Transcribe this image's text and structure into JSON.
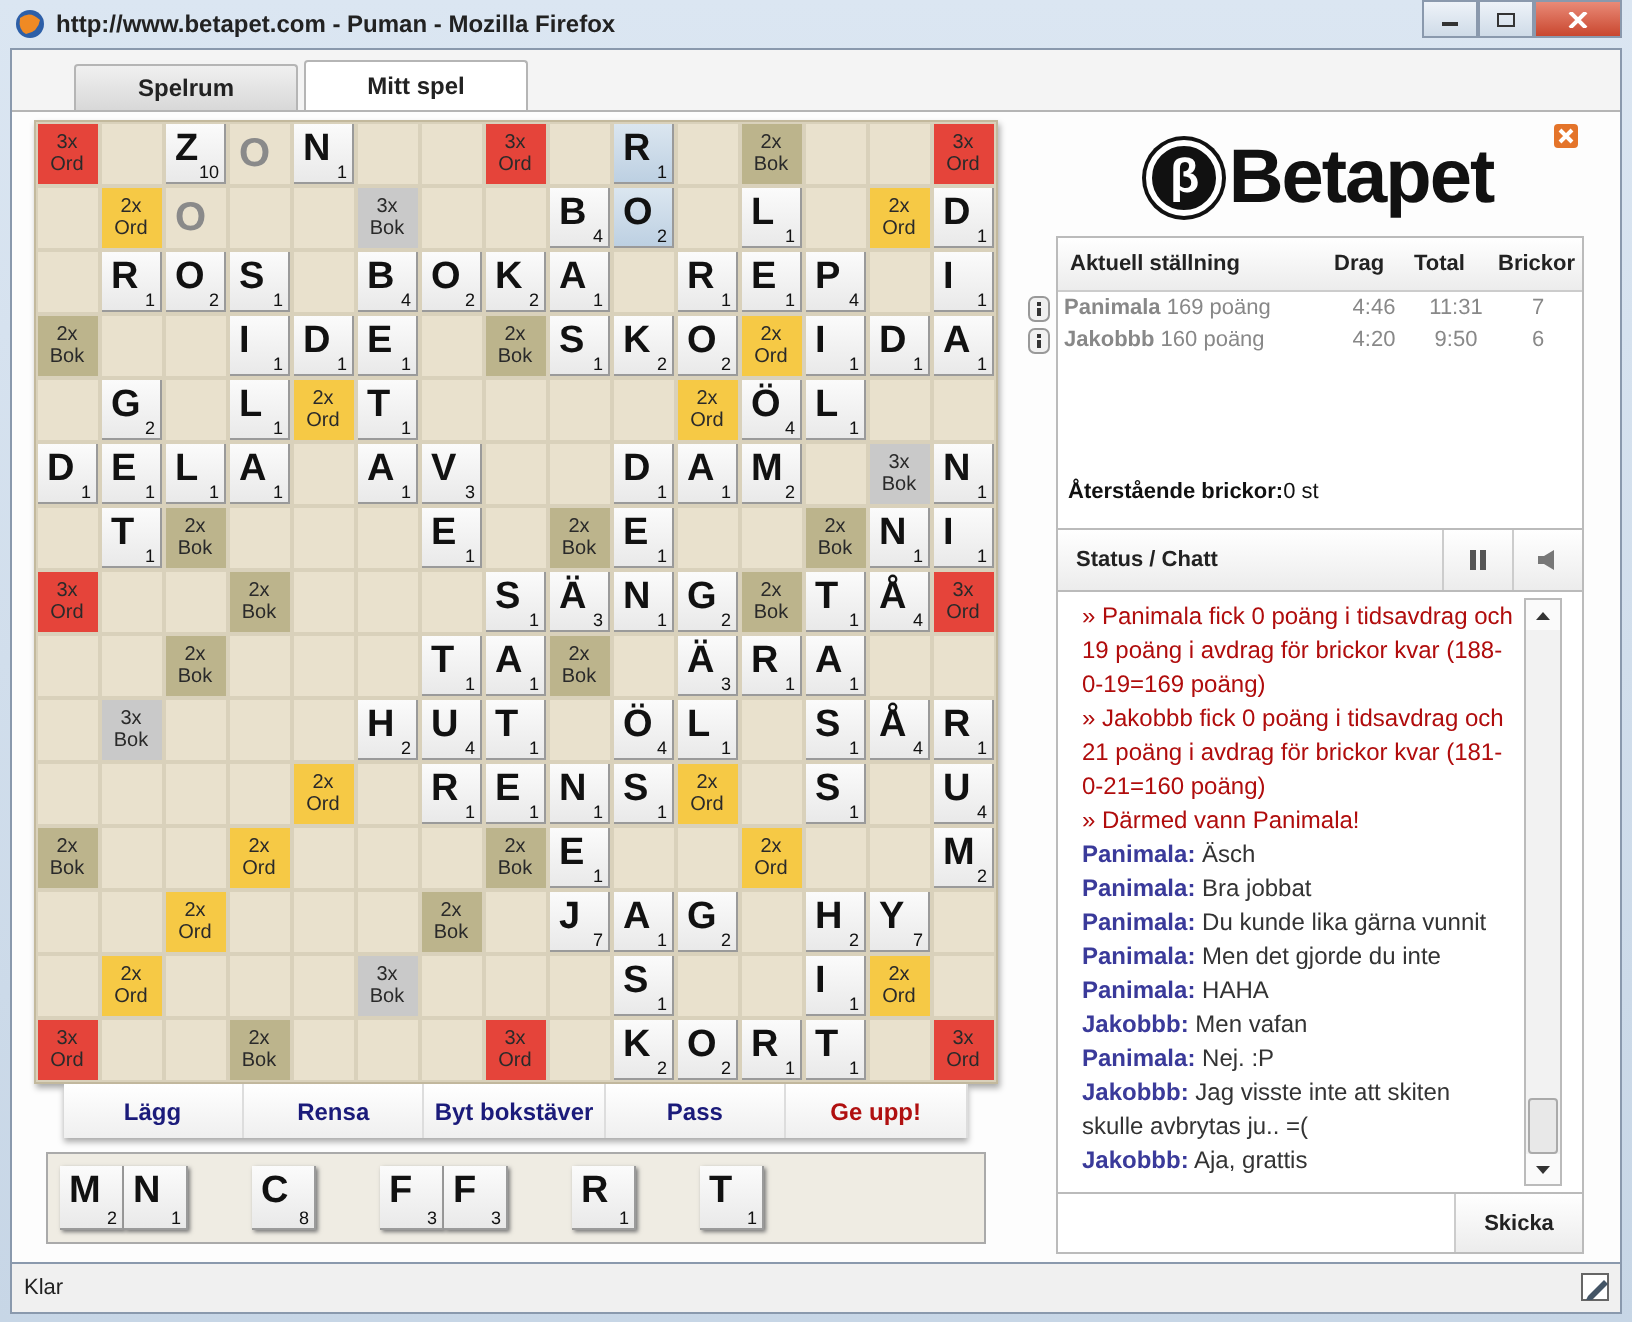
{
  "window": {
    "title": "http://www.betapet.com - Puman - Mozilla Firefox"
  },
  "tabs": [
    {
      "label": "Spelrum",
      "selected": false
    },
    {
      "label": "Mitt spel",
      "selected": true
    }
  ],
  "board": [
    [
      {
        "kind": "bonus",
        "mult": "3x",
        "word": "Ord",
        "color": "#e5443a"
      },
      {
        "kind": "empty"
      },
      {
        "kind": "tile",
        "letter": "Z",
        "points": "10",
        "highlighted": false
      },
      {
        "kind": "blank",
        "letter": "O"
      },
      {
        "kind": "tile",
        "letter": "N",
        "points": "1",
        "highlighted": false
      },
      {
        "kind": "empty"
      },
      {
        "kind": "empty"
      },
      {
        "kind": "bonus",
        "mult": "3x",
        "word": "Ord",
        "color": "#e5443a"
      },
      {
        "kind": "empty"
      },
      {
        "kind": "tile",
        "letter": "R",
        "points": "1",
        "highlighted": true
      },
      {
        "kind": "empty"
      },
      {
        "kind": "bonus",
        "mult": "2x",
        "word": "Bok",
        "color": "#bcb48c"
      },
      {
        "kind": "empty"
      },
      {
        "kind": "empty"
      },
      {
        "kind": "bonus",
        "mult": "3x",
        "word": "Ord",
        "color": "#e5443a"
      }
    ],
    [
      {
        "kind": "empty"
      },
      {
        "kind": "bonus",
        "mult": "2x",
        "word": "Ord",
        "color": "#f6c945"
      },
      {
        "kind": "blank",
        "letter": "O"
      },
      {
        "kind": "empty"
      },
      {
        "kind": "empty"
      },
      {
        "kind": "bonus",
        "mult": "3x",
        "word": "Bok",
        "color": "#c9c9c9"
      },
      {
        "kind": "empty"
      },
      {
        "kind": "empty"
      },
      {
        "kind": "tile",
        "letter": "B",
        "points": "4",
        "highlighted": false
      },
      {
        "kind": "tile",
        "letter": "O",
        "points": "2",
        "highlighted": true
      },
      {
        "kind": "empty"
      },
      {
        "kind": "tile",
        "letter": "L",
        "points": "1",
        "highlighted": false
      },
      {
        "kind": "empty"
      },
      {
        "kind": "bonus",
        "mult": "2x",
        "word": "Ord",
        "color": "#f6c945"
      },
      {
        "kind": "tile",
        "letter": "D",
        "points": "1",
        "highlighted": false
      }
    ],
    [
      {
        "kind": "empty"
      },
      {
        "kind": "tile",
        "letter": "R",
        "points": "1",
        "highlighted": false
      },
      {
        "kind": "tile",
        "letter": "O",
        "points": "2",
        "highlighted": false
      },
      {
        "kind": "tile",
        "letter": "S",
        "points": "1",
        "highlighted": false
      },
      {
        "kind": "empty"
      },
      {
        "kind": "tile",
        "letter": "B",
        "points": "4",
        "highlighted": false
      },
      {
        "kind": "tile",
        "letter": "O",
        "points": "2",
        "highlighted": false
      },
      {
        "kind": "tile",
        "letter": "K",
        "points": "2",
        "highlighted": false
      },
      {
        "kind": "tile",
        "letter": "A",
        "points": "1",
        "highlighted": false
      },
      {
        "kind": "empty"
      },
      {
        "kind": "tile",
        "letter": "R",
        "points": "1",
        "highlighted": false
      },
      {
        "kind": "tile",
        "letter": "E",
        "points": "1",
        "highlighted": false
      },
      {
        "kind": "tile",
        "letter": "P",
        "points": "4",
        "highlighted": false
      },
      {
        "kind": "empty"
      },
      {
        "kind": "tile",
        "letter": "I",
        "points": "1",
        "highlighted": false
      }
    ],
    [
      {
        "kind": "bonus",
        "mult": "2x",
        "word": "Bok",
        "color": "#bcb48c"
      },
      {
        "kind": "empty"
      },
      {
        "kind": "empty"
      },
      {
        "kind": "tile",
        "letter": "I",
        "points": "1",
        "highlighted": false
      },
      {
        "kind": "tile",
        "letter": "D",
        "points": "1",
        "highlighted": false
      },
      {
        "kind": "tile",
        "letter": "E",
        "points": "1",
        "highlighted": false
      },
      {
        "kind": "empty"
      },
      {
        "kind": "bonus",
        "mult": "2x",
        "word": "Bok",
        "color": "#bcb48c"
      },
      {
        "kind": "tile",
        "letter": "S",
        "points": "1",
        "highlighted": false
      },
      {
        "kind": "tile",
        "letter": "K",
        "points": "2",
        "highlighted": false
      },
      {
        "kind": "tile",
        "letter": "O",
        "points": "2",
        "highlighted": false
      },
      {
        "kind": "bonus",
        "mult": "2x",
        "word": "Ord",
        "color": "#f6c945"
      },
      {
        "kind": "tile",
        "letter": "I",
        "points": "1",
        "highlighted": false
      },
      {
        "kind": "tile",
        "letter": "D",
        "points": "1",
        "highlighted": false
      },
      {
        "kind": "tile",
        "letter": "A",
        "points": "1",
        "highlighted": false
      }
    ],
    [
      {
        "kind": "empty"
      },
      {
        "kind": "tile",
        "letter": "G",
        "points": "2",
        "highlighted": false
      },
      {
        "kind": "empty"
      },
      {
        "kind": "tile",
        "letter": "L",
        "points": "1",
        "highlighted": false
      },
      {
        "kind": "bonus",
        "mult": "2x",
        "word": "Ord",
        "color": "#f6c945"
      },
      {
        "kind": "tile",
        "letter": "T",
        "points": "1",
        "highlighted": false
      },
      {
        "kind": "empty"
      },
      {
        "kind": "empty"
      },
      {
        "kind": "empty"
      },
      {
        "kind": "empty"
      },
      {
        "kind": "bonus",
        "mult": "2x",
        "word": "Ord",
        "color": "#f6c945"
      },
      {
        "kind": "tile",
        "letter": "Ö",
        "points": "4",
        "highlighted": false
      },
      {
        "kind": "tile",
        "letter": "L",
        "points": "1",
        "highlighted": false
      },
      {
        "kind": "empty"
      },
      {
        "kind": "empty"
      }
    ],
    [
      {
        "kind": "tile",
        "letter": "D",
        "points": "1",
        "highlighted": false
      },
      {
        "kind": "tile",
        "letter": "E",
        "points": "1",
        "highlighted": false
      },
      {
        "kind": "tile",
        "letter": "L",
        "points": "1",
        "highlighted": false
      },
      {
        "kind": "tile",
        "letter": "A",
        "points": "1",
        "highlighted": false
      },
      {
        "kind": "empty"
      },
      {
        "kind": "tile",
        "letter": "A",
        "points": "1",
        "highlighted": false
      },
      {
        "kind": "tile",
        "letter": "V",
        "points": "3",
        "highlighted": false
      },
      {
        "kind": "empty"
      },
      {
        "kind": "empty"
      },
      {
        "kind": "tile",
        "letter": "D",
        "points": "1",
        "highlighted": false
      },
      {
        "kind": "tile",
        "letter": "A",
        "points": "1",
        "highlighted": false
      },
      {
        "kind": "tile",
        "letter": "M",
        "points": "2",
        "highlighted": false
      },
      {
        "kind": "empty"
      },
      {
        "kind": "bonus",
        "mult": "3x",
        "word": "Bok",
        "color": "#c9c9c9"
      },
      {
        "kind": "tile",
        "letter": "N",
        "points": "1",
        "highlighted": false
      }
    ],
    [
      {
        "kind": "empty"
      },
      {
        "kind": "tile",
        "letter": "T",
        "points": "1",
        "highlighted": false
      },
      {
        "kind": "bonus",
        "mult": "2x",
        "word": "Bok",
        "color": "#bcb48c"
      },
      {
        "kind": "empty"
      },
      {
        "kind": "empty"
      },
      {
        "kind": "empty"
      },
      {
        "kind": "tile",
        "letter": "E",
        "points": "1",
        "highlighted": false
      },
      {
        "kind": "empty"
      },
      {
        "kind": "bonus",
        "mult": "2x",
        "word": "Bok",
        "color": "#bcb48c"
      },
      {
        "kind": "tile",
        "letter": "E",
        "points": "1",
        "highlighted": false
      },
      {
        "kind": "empty"
      },
      {
        "kind": "empty"
      },
      {
        "kind": "bonus",
        "mult": "2x",
        "word": "Bok",
        "color": "#bcb48c"
      },
      {
        "kind": "tile",
        "letter": "N",
        "points": "1",
        "highlighted": false
      },
      {
        "kind": "tile",
        "letter": "I",
        "points": "1",
        "highlighted": false
      }
    ],
    [
      {
        "kind": "bonus",
        "mult": "3x",
        "word": "Ord",
        "color": "#e5443a"
      },
      {
        "kind": "empty"
      },
      {
        "kind": "empty"
      },
      {
        "kind": "bonus",
        "mult": "2x",
        "word": "Bok",
        "color": "#bcb48c"
      },
      {
        "kind": "empty"
      },
      {
        "kind": "empty"
      },
      {
        "kind": "empty"
      },
      {
        "kind": "tile",
        "letter": "S",
        "points": "1",
        "highlighted": false
      },
      {
        "kind": "tile",
        "letter": "Ä",
        "points": "3",
        "highlighted": false
      },
      {
        "kind": "tile",
        "letter": "N",
        "points": "1",
        "highlighted": false
      },
      {
        "kind": "tile",
        "letter": "G",
        "points": "2",
        "highlighted": false
      },
      {
        "kind": "bonus",
        "mult": "2x",
        "word": "Bok",
        "color": "#bcb48c"
      },
      {
        "kind": "tile",
        "letter": "T",
        "points": "1",
        "highlighted": false
      },
      {
        "kind": "tile",
        "letter": "Å",
        "points": "4",
        "highlighted": false
      },
      {
        "kind": "bonus",
        "mult": "3x",
        "word": "Ord",
        "color": "#e5443a"
      }
    ],
    [
      {
        "kind": "empty"
      },
      {
        "kind": "empty"
      },
      {
        "kind": "bonus",
        "mult": "2x",
        "word": "Bok",
        "color": "#bcb48c"
      },
      {
        "kind": "empty"
      },
      {
        "kind": "empty"
      },
      {
        "kind": "empty"
      },
      {
        "kind": "tile",
        "letter": "T",
        "points": "1",
        "highlighted": false
      },
      {
        "kind": "tile",
        "letter": "A",
        "points": "1",
        "highlighted": false
      },
      {
        "kind": "bonus",
        "mult": "2x",
        "word": "Bok",
        "color": "#bcb48c"
      },
      {
        "kind": "empty"
      },
      {
        "kind": "tile",
        "letter": "Ä",
        "points": "3",
        "highlighted": false
      },
      {
        "kind": "tile",
        "letter": "R",
        "points": "1",
        "highlighted": false
      },
      {
        "kind": "tile",
        "letter": "A",
        "points": "1",
        "highlighted": false
      },
      {
        "kind": "empty"
      },
      {
        "kind": "empty"
      }
    ],
    [
      {
        "kind": "empty"
      },
      {
        "kind": "bonus",
        "mult": "3x",
        "word": "Bok",
        "color": "#c9c9c9"
      },
      {
        "kind": "empty"
      },
      {
        "kind": "empty"
      },
      {
        "kind": "empty"
      },
      {
        "kind": "tile",
        "letter": "H",
        "points": "2",
        "highlighted": false
      },
      {
        "kind": "tile",
        "letter": "U",
        "points": "4",
        "highlighted": false
      },
      {
        "kind": "tile",
        "letter": "T",
        "points": "1",
        "highlighted": false
      },
      {
        "kind": "empty"
      },
      {
        "kind": "tile",
        "letter": "Ö",
        "points": "4",
        "highlighted": false
      },
      {
        "kind": "tile",
        "letter": "L",
        "points": "1",
        "highlighted": false
      },
      {
        "kind": "empty"
      },
      {
        "kind": "tile",
        "letter": "S",
        "points": "1",
        "highlighted": false
      },
      {
        "kind": "tile",
        "letter": "Å",
        "points": "4",
        "highlighted": false
      },
      {
        "kind": "tile",
        "letter": "R",
        "points": "1",
        "highlighted": false
      }
    ],
    [
      {
        "kind": "empty"
      },
      {
        "kind": "empty"
      },
      {
        "kind": "empty"
      },
      {
        "kind": "empty"
      },
      {
        "kind": "bonus",
        "mult": "2x",
        "word": "Ord",
        "color": "#f6c945"
      },
      {
        "kind": "empty"
      },
      {
        "kind": "tile",
        "letter": "R",
        "points": "1",
        "highlighted": false
      },
      {
        "kind": "tile",
        "letter": "E",
        "points": "1",
        "highlighted": false
      },
      {
        "kind": "tile",
        "letter": "N",
        "points": "1",
        "highlighted": false
      },
      {
        "kind": "tile",
        "letter": "S",
        "points": "1",
        "highlighted": false
      },
      {
        "kind": "bonus",
        "mult": "2x",
        "word": "Ord",
        "color": "#f6c945"
      },
      {
        "kind": "empty"
      },
      {
        "kind": "tile",
        "letter": "S",
        "points": "1",
        "highlighted": false
      },
      {
        "kind": "empty"
      },
      {
        "kind": "tile",
        "letter": "U",
        "points": "4",
        "highlighted": false
      }
    ],
    [
      {
        "kind": "bonus",
        "mult": "2x",
        "word": "Bok",
        "color": "#bcb48c"
      },
      {
        "kind": "empty"
      },
      {
        "kind": "empty"
      },
      {
        "kind": "bonus",
        "mult": "2x",
        "word": "Ord",
        "color": "#f6c945"
      },
      {
        "kind": "empty"
      },
      {
        "kind": "empty"
      },
      {
        "kind": "empty"
      },
      {
        "kind": "bonus",
        "mult": "2x",
        "word": "Bok",
        "color": "#bcb48c"
      },
      {
        "kind": "tile",
        "letter": "E",
        "points": "1",
        "highlighted": false
      },
      {
        "kind": "empty"
      },
      {
        "kind": "empty"
      },
      {
        "kind": "bonus",
        "mult": "2x",
        "word": "Ord",
        "color": "#f6c945"
      },
      {
        "kind": "empty"
      },
      {
        "kind": "empty"
      },
      {
        "kind": "tile",
        "letter": "M",
        "points": "2",
        "highlighted": false
      }
    ],
    [
      {
        "kind": "empty"
      },
      {
        "kind": "empty"
      },
      {
        "kind": "bonus",
        "mult": "2x",
        "word": "Ord",
        "color": "#f6c945"
      },
      {
        "kind": "empty"
      },
      {
        "kind": "empty"
      },
      {
        "kind": "empty"
      },
      {
        "kind": "bonus",
        "mult": "2x",
        "word": "Bok",
        "color": "#bcb48c"
      },
      {
        "kind": "empty"
      },
      {
        "kind": "tile",
        "letter": "J",
        "points": "7",
        "highlighted": false
      },
      {
        "kind": "tile",
        "letter": "A",
        "points": "1",
        "highlighted": false
      },
      {
        "kind": "tile",
        "letter": "G",
        "points": "2",
        "highlighted": false
      },
      {
        "kind": "empty"
      },
      {
        "kind": "tile",
        "letter": "H",
        "points": "2",
        "highlighted": false
      },
      {
        "kind": "tile",
        "letter": "Y",
        "points": "7",
        "highlighted": false
      },
      {
        "kind": "empty"
      }
    ],
    [
      {
        "kind": "empty"
      },
      {
        "kind": "bonus",
        "mult": "2x",
        "word": "Ord",
        "color": "#f6c945"
      },
      {
        "kind": "empty"
      },
      {
        "kind": "empty"
      },
      {
        "kind": "empty"
      },
      {
        "kind": "bonus",
        "mult": "3x",
        "word": "Bok",
        "color": "#c9c9c9"
      },
      {
        "kind": "empty"
      },
      {
        "kind": "empty"
      },
      {
        "kind": "empty"
      },
      {
        "kind": "tile",
        "letter": "S",
        "points": "1",
        "highlighted": false
      },
      {
        "kind": "empty"
      },
      {
        "kind": "empty"
      },
      {
        "kind": "tile",
        "letter": "I",
        "points": "1",
        "highlighted": false
      },
      {
        "kind": "bonus",
        "mult": "2x",
        "word": "Ord",
        "color": "#f6c945"
      },
      {
        "kind": "empty"
      }
    ],
    [
      {
        "kind": "bonus",
        "mult": "3x",
        "word": "Ord",
        "color": "#e5443a"
      },
      {
        "kind": "empty"
      },
      {
        "kind": "empty"
      },
      {
        "kind": "bonus",
        "mult": "2x",
        "word": "Bok",
        "color": "#bcb48c"
      },
      {
        "kind": "empty"
      },
      {
        "kind": "empty"
      },
      {
        "kind": "empty"
      },
      {
        "kind": "bonus",
        "mult": "3x",
        "word": "Ord",
        "color": "#e5443a"
      },
      {
        "kind": "empty"
      },
      {
        "kind": "tile",
        "letter": "K",
        "points": "2",
        "highlighted": false
      },
      {
        "kind": "tile",
        "letter": "O",
        "points": "2",
        "highlighted": false
      },
      {
        "kind": "tile",
        "letter": "R",
        "points": "1",
        "highlighted": false
      },
      {
        "kind": "tile",
        "letter": "T",
        "points": "1",
        "highlighted": false
      },
      {
        "kind": "empty"
      },
      {
        "kind": "bonus",
        "mult": "3x",
        "word": "Ord",
        "color": "#e5443a"
      }
    ]
  ],
  "actions": [
    {
      "label": "Lägg",
      "kind": "normal"
    },
    {
      "label": "Rensa",
      "kind": "normal"
    },
    {
      "label": "Byt bokstäver",
      "kind": "normal"
    },
    {
      "label": "Pass",
      "kind": "normal"
    },
    {
      "label": "Ge upp!",
      "kind": "danger"
    }
  ],
  "rack": [
    {
      "kind": "tile",
      "letter": "M",
      "points": "2"
    },
    {
      "kind": "tile",
      "letter": "N",
      "points": "1"
    },
    {
      "kind": "empty"
    },
    {
      "kind": "tile",
      "letter": "C",
      "points": "8"
    },
    {
      "kind": "empty"
    },
    {
      "kind": "tile",
      "letter": "F",
      "points": "3"
    },
    {
      "kind": "tile",
      "letter": "F",
      "points": "3"
    },
    {
      "kind": "empty"
    },
    {
      "kind": "tile",
      "letter": "R",
      "points": "1"
    },
    {
      "kind": "empty"
    },
    {
      "kind": "tile",
      "letter": "T",
      "points": "1"
    }
  ],
  "logo": {
    "symbol": "β",
    "text": "Betapet"
  },
  "scoreboard": {
    "columns": [
      "Aktuell ställning",
      "Drag",
      "Total",
      "Brickor"
    ],
    "rows": [
      {
        "name": "Panimala",
        "score": "169 poäng",
        "drag": "4:46",
        "total": "11:31",
        "tiles": "7"
      },
      {
        "name": "Jakobbb",
        "score": "160 poäng",
        "drag": "4:20",
        "total": "9:50",
        "tiles": "6"
      }
    ],
    "remaining_label": "Återstående brickor:",
    "remaining_value": "0 st"
  },
  "chat": {
    "title": "Status / Chatt",
    "messages": [
      {
        "kind": "system",
        "text": "» Panimala fick 0 poäng i tidsavdrag och 19 poäng i avdrag för brickor kvar (188-0-19=169 poäng)"
      },
      {
        "kind": "system",
        "text": "» Jakobbb fick 0 poäng i tidsavdrag och 21 poäng i avdrag för brickor kvar (181-0-21=160 poäng)"
      },
      {
        "kind": "system",
        "text": "» Därmed vann Panimala!"
      },
      {
        "kind": "chat",
        "author": "Panimala:",
        "text": "Äsch"
      },
      {
        "kind": "chat",
        "author": "Panimala:",
        "text": "Bra jobbat"
      },
      {
        "kind": "chat",
        "author": "Panimala:",
        "text": "Du kunde lika gärna vunnit"
      },
      {
        "kind": "chat",
        "author": "Panimala:",
        "text": "Men det gjorde du inte"
      },
      {
        "kind": "chat",
        "author": "Panimala:",
        "text": "HAHA"
      },
      {
        "kind": "chat",
        "author": "Jakobbb:",
        "text": "Men vafan"
      },
      {
        "kind": "chat",
        "author": "Panimala:",
        "text": "Nej. :P"
      },
      {
        "kind": "chat",
        "author": "Jakobbb:",
        "text": "Jag visste inte att skiten skulle avbrytas ju.. =("
      },
      {
        "kind": "chat",
        "author": "Jakobbb:",
        "text": "Aja, grattis"
      }
    ],
    "send": "Skicka"
  },
  "status_bar": {
    "text": "Klar"
  }
}
